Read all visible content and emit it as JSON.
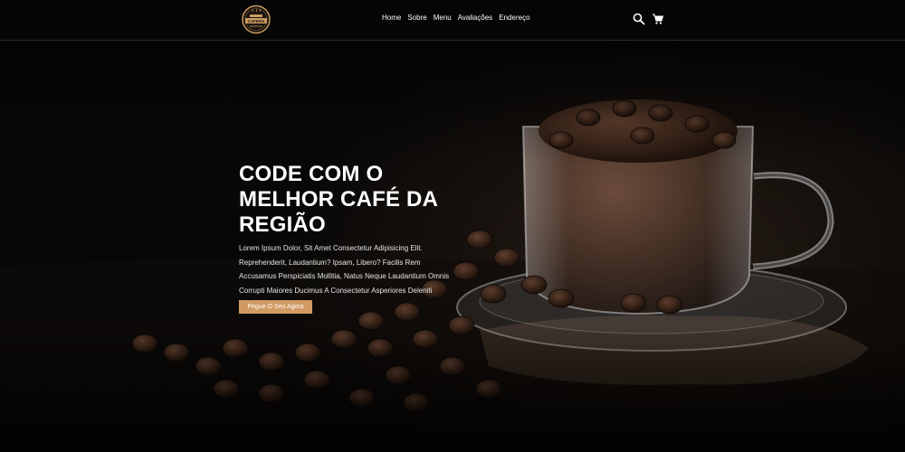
{
  "header": {
    "logo_text": "CAFERA",
    "nav": [
      "Home",
      "Sobre",
      "Menu",
      "Avaliações",
      "Endereço"
    ]
  },
  "icons": {
    "search": "search-icon",
    "cart": "cart-icon"
  },
  "hero": {
    "title": "CODE COM O MELHOR CAFÉ DA REGIÃO",
    "text": "Lorem Ipsum Dolor, Sit Amet Consectetur Adipisicing Elit. Reprehenderit, Laudantium? Ipsam, Libero? Facilis Rem Accusamus Perspiciatis Mollitia, Natus Neque Laudantium Omnis Corrupti Maiores Ducimus A Consectetur Asperiores Deleniti Repellat Placeat.",
    "button": "Pegue O Seu Agora"
  },
  "colors": {
    "accent": "#d29a63",
    "background": "#0a0a0a"
  }
}
